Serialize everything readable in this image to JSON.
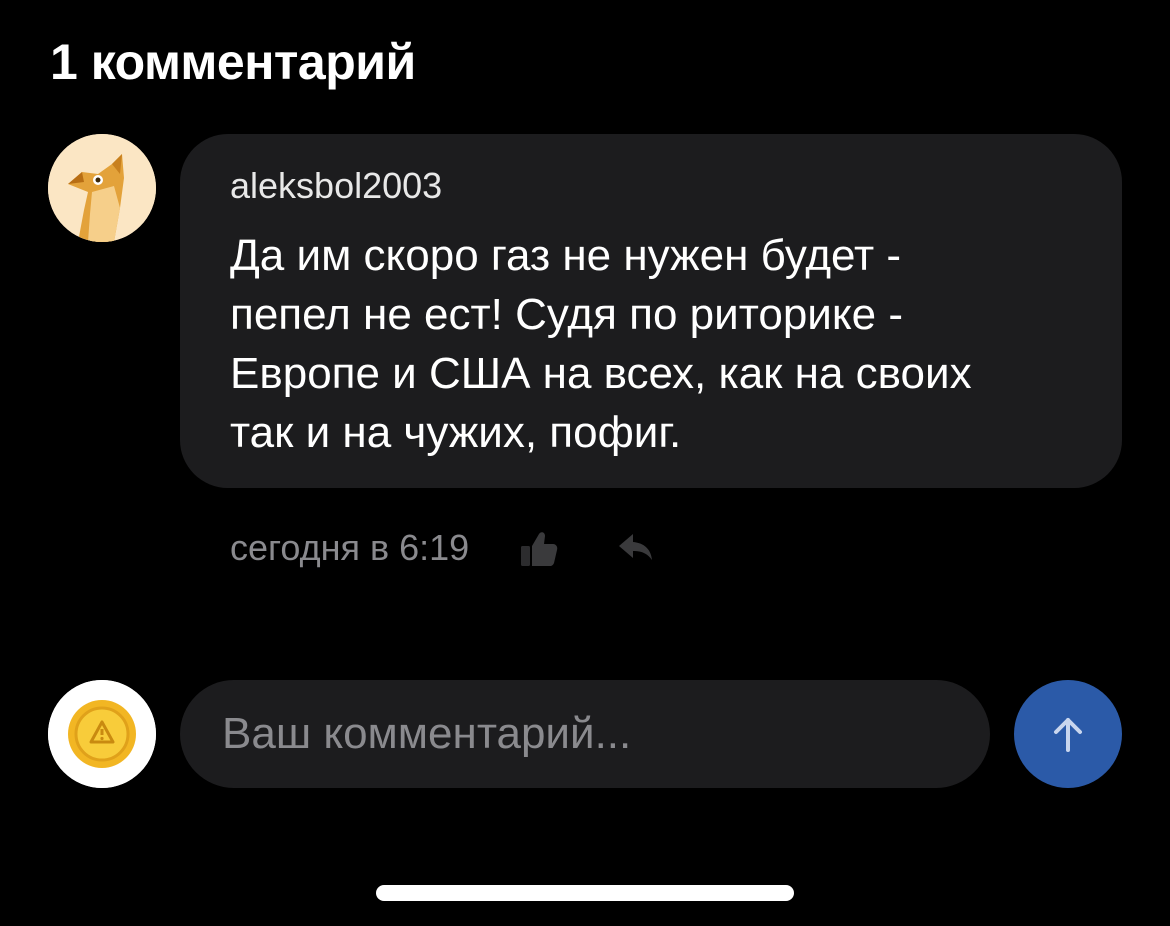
{
  "header": {
    "title": "1 комментарий"
  },
  "comment": {
    "avatar_icon": "owl-avatar-icon",
    "username": "aleksbol2003",
    "lines": [
      "Да им скоро газ не нужен будет -",
      "пепел не ест! Судя по риторике -",
      "Европе и США на всех, как на своих",
      "так и на чужих, пофиг."
    ],
    "timestamp": "сегодня в 6:19",
    "like_icon": "thumbs-up-icon",
    "reply_icon": "reply-arrow-icon"
  },
  "composer": {
    "avatar_icon": "coin-avatar-icon",
    "placeholder": "Ваш комментарий...",
    "value": "",
    "send_icon": "arrow-up-icon"
  },
  "colors": {
    "background": "#000000",
    "bubble": "#1c1c1e",
    "muted_text": "#8a8a8e",
    "send_button": "#2b5aa8"
  }
}
